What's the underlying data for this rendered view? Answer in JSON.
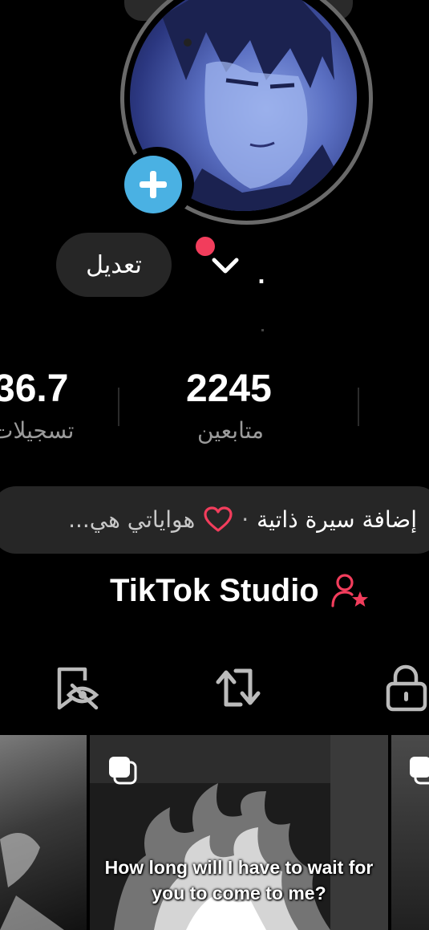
{
  "profile": {
    "edit_label": "تعديل",
    "username": ".",
    "avatar_icon": "anime-avatar-image",
    "add_icon": "plus-icon"
  },
  "stats": [
    {
      "value": "36.7",
      "label": "تسجيلات"
    },
    {
      "value": "2245",
      "label": "متابعين"
    }
  ],
  "bio": {
    "add_bio": "إضافة سيرة ذاتية",
    "separator": "·",
    "interests": "هواياتي هي...",
    "heart_icon": "heart-outline-icon"
  },
  "studio": {
    "label": "TikTok Studio",
    "icon": "creator-star-icon"
  },
  "tabs": [
    {
      "name": "hidden-videos",
      "icon": "eye-off-icon"
    },
    {
      "name": "reposts",
      "icon": "repost-icon"
    },
    {
      "name": "private",
      "icon": "lock-icon"
    }
  ],
  "videos": [
    {
      "caption": ""
    },
    {
      "caption": "How long will I have to wait for you to come to me?"
    },
    {
      "caption": ""
    }
  ],
  "colors": {
    "background": "#000000",
    "accent_blue": "#4ab1e3",
    "notification_red": "#f23d5c",
    "pill_gray": "#262626"
  }
}
